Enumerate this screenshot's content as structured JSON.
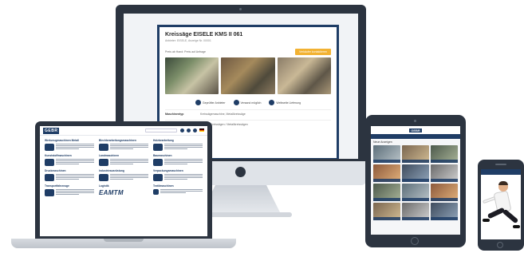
{
  "desktop": {
    "listing_title": "Kreissäge EISELE KMS II 061",
    "listing_subtitle": "Anbieter: EISELE, Anzeige Nr. 00001",
    "listing_meta": "Preis ab Hand: Preis auf Anfrage",
    "contact_button": "Verkäufer kontaktieren",
    "features": [
      {
        "icon": "shield-icon",
        "label": "Geprüfter Anbieter"
      },
      {
        "icon": "truck-icon",
        "label": "Versand möglich"
      },
      {
        "icon": "globe-icon",
        "label": "Weltweite Lieferung"
      }
    ],
    "details": [
      {
        "key": "Maschinentyp",
        "value": "Kreissägemaschine, Metallkreissäge"
      },
      {
        "key": "Kategorie",
        "value": "Sägen / Kreissägen / Metallkreissägen"
      }
    ]
  },
  "laptop": {
    "logo": "GEBR",
    "categories": [
      "Werkzeugmaschinen Metall",
      "Blechbearbeitungsmaschinen",
      "Holzbearbeitung",
      "Kunststoffmaschinen",
      "Landmaschinen",
      "Baumaschinen",
      "Druckmaschinen",
      "Industrieausrüstung",
      "Verpackungsmaschinen",
      "Transportfahrzeuge",
      "Logistik",
      "Textilmaschinen"
    ],
    "partner_logo": "EAMTM"
  },
  "tablet": {
    "logo": "GEBR",
    "section_title": "Neue Anzeigen"
  },
  "colors": {
    "brand": "#1f3d66",
    "accent": "#f2b233",
    "device_frame": "#2c3440"
  }
}
